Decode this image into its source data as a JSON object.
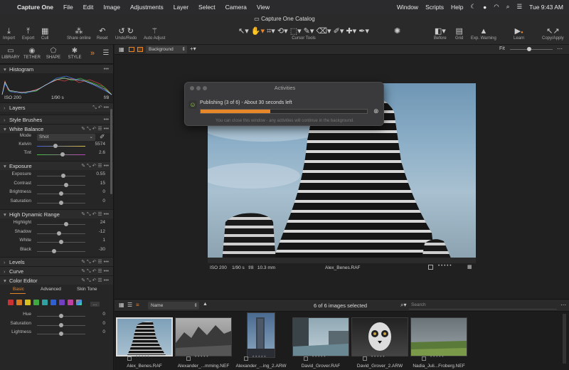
{
  "menubar": {
    "app": "Capture One",
    "items": [
      "File",
      "Edit",
      "Image",
      "Adjustments",
      "Layer",
      "Select",
      "Camera",
      "View"
    ],
    "right_items": [
      "Window",
      "Scripts",
      "Help"
    ],
    "clock": "Tue 9:43 AM"
  },
  "window": {
    "title": "Capture One Catalog"
  },
  "toolbar": {
    "left": [
      {
        "label": "Import",
        "icon": "import-icon"
      },
      {
        "label": "Export",
        "icon": "export-icon"
      },
      {
        "label": "Cull",
        "icon": "cull-icon"
      },
      {
        "label": "Share online",
        "icon": "share-icon"
      },
      {
        "label": "Reset",
        "icon": "reset-icon"
      },
      {
        "label": "Undo/Redo",
        "icon": "undo-icon"
      },
      {
        "label": "Auto Adjust",
        "icon": "wand-icon"
      }
    ],
    "center_label": "Cursor Tools",
    "right": [
      {
        "label": "Before",
        "icon": "before-icon"
      },
      {
        "label": "Grid",
        "icon": "grid-icon"
      },
      {
        "label": "Exp. Warning",
        "icon": "warning-icon"
      },
      {
        "label": "Learn",
        "icon": "learn-icon"
      },
      {
        "label": "Copy/Apply",
        "icon": "copy-apply-icon"
      }
    ]
  },
  "tooltabs": [
    {
      "label": "LIBRARY"
    },
    {
      "label": "TETHER"
    },
    {
      "label": "SHAPE"
    },
    {
      "label": "STYLE"
    }
  ],
  "histogram": {
    "title": "Histogram",
    "iso": "ISO 200",
    "shutter": "1/90 s",
    "aperture": "f/8"
  },
  "sections": {
    "layers": "Layers",
    "style_brushes": "Style Brushes",
    "white_balance": "White Balance",
    "exposure": "Exposure",
    "hdr": "High Dynamic Range",
    "levels": "Levels",
    "curve": "Curve",
    "color_editor": "Color Editor"
  },
  "white_balance": {
    "mode_label": "Mode",
    "mode_value": "Shot",
    "kelvin_label": "Kelvin",
    "kelvin": "5574",
    "tint_label": "Tint",
    "tint": "2.6"
  },
  "exposure": [
    {
      "label": "Exposure",
      "value": "0.55",
      "pos": 0.55
    },
    {
      "label": "Contrast",
      "value": "15",
      "pos": 0.6
    },
    {
      "label": "Brightness",
      "value": "0",
      "pos": 0.5
    },
    {
      "label": "Saturation",
      "value": "0",
      "pos": 0.5
    }
  ],
  "hdr": [
    {
      "label": "Highlight",
      "value": "24",
      "pos": 0.6
    },
    {
      "label": "Shadow",
      "value": "-12",
      "pos": 0.45
    },
    {
      "label": "White",
      "value": "1",
      "pos": 0.5
    },
    {
      "label": "Black",
      "value": "-30",
      "pos": 0.36
    }
  ],
  "color_editor": {
    "tabs": [
      "Basic",
      "Advanced",
      "Skin Tone"
    ],
    "swatches": [
      "#c83232",
      "#d47a22",
      "#d8c020",
      "#40a840",
      "#30a0a0",
      "#3060d0",
      "#7040c0",
      "#c040a0"
    ],
    "rows": [
      {
        "label": "Hue",
        "value": "0"
      },
      {
        "label": "Saturation",
        "value": "0"
      },
      {
        "label": "Lightness",
        "value": "0"
      }
    ]
  },
  "viewer": {
    "layer": "Background",
    "fit": "Fit",
    "iso": "ISO 200",
    "shutter": "1/90 s",
    "aperture": "f/8",
    "focal": "10.3 mm",
    "filename": "Alex_Benes.RAF"
  },
  "activities": {
    "title": "Activities",
    "status": "Publishing (3 of 6) - About 30 seconds left",
    "note": "You can close this window - any activities will continue in the background.",
    "progress": 0.42
  },
  "browser": {
    "sort": "Name",
    "count": "6 of 6 images selected",
    "search_placeholder": "Search",
    "thumbs": [
      {
        "name": "Alex_Benes.RAF"
      },
      {
        "name": "Alexander_...mming.NEF"
      },
      {
        "name": "Alexander_...ing_2.ARW"
      },
      {
        "name": "David_Grover.RAF"
      },
      {
        "name": "David_Grover_2.ARW"
      },
      {
        "name": "Nadia_Juli...Froberg.NEF"
      }
    ]
  },
  "colors": {
    "accent": "#e8862a",
    "bg": "#1e1e1e",
    "panel": "#262626"
  }
}
